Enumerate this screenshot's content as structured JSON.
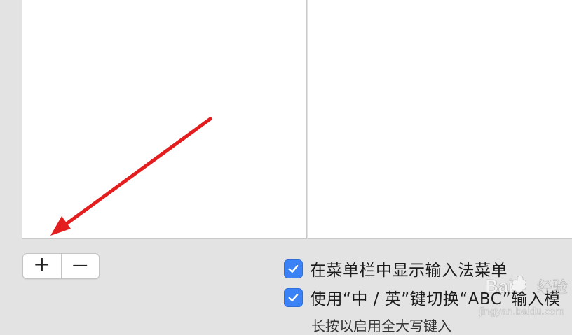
{
  "panes": {
    "list": {},
    "detail": {}
  },
  "buttons": {
    "add_symbol": "+",
    "remove_symbol": "—"
  },
  "options": [
    {
      "label": "在菜单栏中显示输入法菜单",
      "checked": true
    },
    {
      "label": "使用“中 / 英”键切换“ABC”输入模",
      "checked": true
    }
  ],
  "hint_text": "长按以启用全大写键入",
  "watermark": {
    "brand": "Bai",
    "brand_suffix": "经验",
    "url": "jingyan.baidu.com"
  },
  "colors": {
    "checkbox": "#3b82f6",
    "arrow": "#e41e1e"
  }
}
